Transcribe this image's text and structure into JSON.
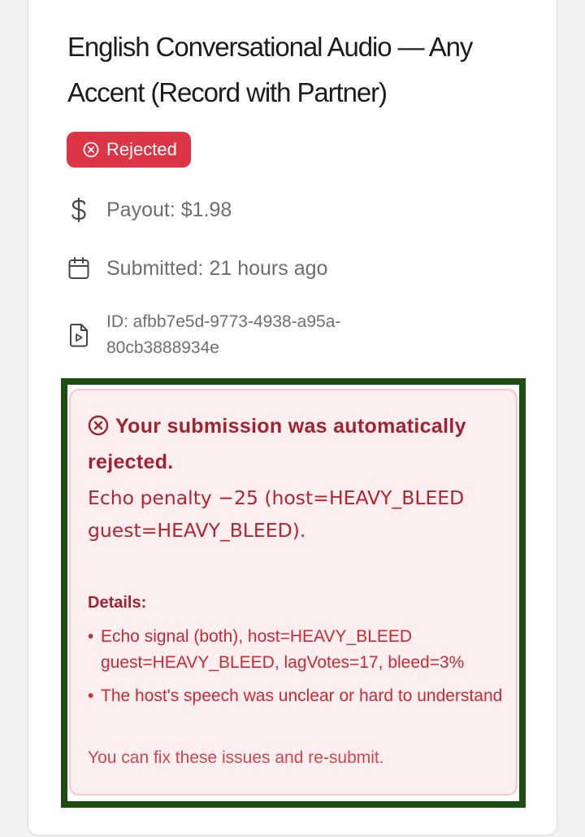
{
  "task": {
    "title": "English Conversational Audio — Any Accent (Record with Partner)",
    "status_badge": "Rejected",
    "payout": "Payout: $1.98",
    "submitted": "Submitted: 21 hours ago",
    "id": "ID: afbb7e5d-9773-4938-a95a-80cb3888934e"
  },
  "rejection": {
    "heading": "Your submission was automatically rejected.",
    "reason": "Echo penalty −25 (host=HEAVY_BLEED guest=HEAVY_BLEED).",
    "details_label": "Details:",
    "details": [
      "Echo signal (both), host=HEAVY_BLEED guest=HEAVY_BLEED, lagVotes=17, bleed=3%",
      "The host's speech was unclear or hard to understand"
    ],
    "footer": "You can fix these issues and re-submit."
  },
  "colors": {
    "badge_bg": "#dc3545",
    "alert_bg": "#fdeeef",
    "alert_text": "#a1232f",
    "highlight_border": "#1b4e10"
  },
  "icons": {
    "badge": "x-circle-icon",
    "payout": "dollar-sign-icon",
    "submitted": "calendar-icon",
    "id": "file-video-icon",
    "alert": "x-circle-icon"
  }
}
